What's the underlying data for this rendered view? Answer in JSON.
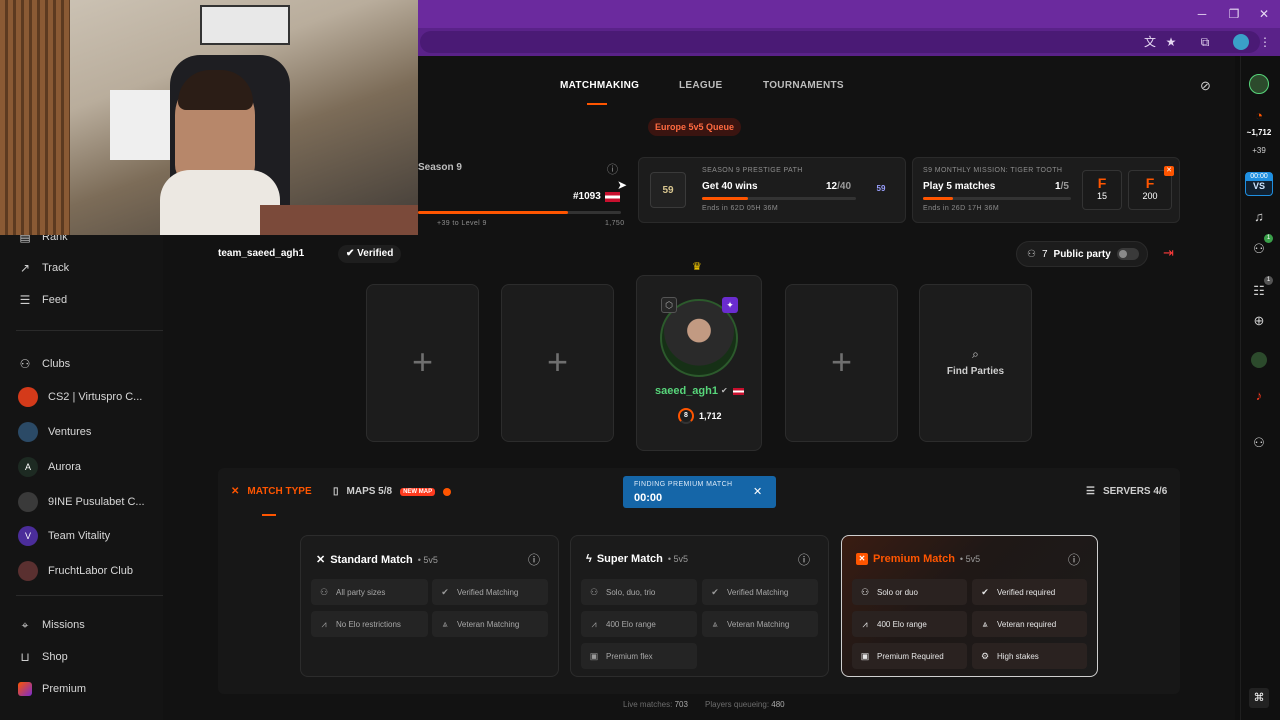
{
  "colors": {
    "accent": "#ff5500",
    "chrome": "#6b2a9e",
    "finding": "#1566a8"
  },
  "nav": {
    "matchmaking": "MATCHMAKING",
    "league": "LEAGUE",
    "tournaments": "TOURNAMENTS"
  },
  "queue_badge": "Europe 5v5 Queue",
  "season": {
    "label": "Season 9",
    "rank_pos": "#1093",
    "to_level": "+39 to Level 9",
    "max": "1,750"
  },
  "prestige": {
    "header": "SEASON 9 PRESTIGE PATH",
    "task": "Get 40 wins",
    "count": "12",
    "total": "/40",
    "ends": "Ends in 62D 05H 36M",
    "badge": "59",
    "progress": 0.3
  },
  "mission": {
    "header": "S9 MONTHLY MISSION: TIGER TOOTH",
    "task": "Play 5 matches",
    "count": "1",
    "total": "/5",
    "ends": "Ends in 26D 17H 36M",
    "reward1": "15",
    "reward2": "200",
    "progress": 0.2
  },
  "team": {
    "name": "team_saeed_agh1",
    "verified": "Verified",
    "party_count": "7",
    "public_party": "Public party"
  },
  "player": {
    "name": "saeed_agh1",
    "level": "8",
    "elo": "1,712"
  },
  "find_parties": "Find Parties",
  "tabs": {
    "match_type": "MATCH TYPE",
    "maps": "MAPS 5/8",
    "new_map": "NEW MAP",
    "servers": "SERVERS 4/6"
  },
  "finding": {
    "label": "FINDING PREMIUM MATCH",
    "timer": "00:00"
  },
  "cards": [
    {
      "title": "Standard Match",
      "mode": "• 5v5",
      "chips": [
        "All party sizes",
        "Verified Matching",
        "No Elo restrictions",
        "Veteran Matching"
      ]
    },
    {
      "title": "Super Match",
      "mode": "• 5v5",
      "chips": [
        "Solo, duo, trio",
        "Verified Matching",
        "400 Elo range",
        "Veteran Matching",
        "Premium flex"
      ]
    },
    {
      "title": "Premium Match",
      "mode": "• 5v5",
      "chips": [
        "Solo or duo",
        "Verified required",
        "400 Elo range",
        "Veteran required",
        "Premium Required",
        "High stakes"
      ]
    }
  ],
  "footer": {
    "live_label": "Live matches:",
    "live": "703",
    "queue_label": "Players queueing:",
    "queue": "480"
  },
  "sidebar": {
    "rank": "Rank",
    "track": "Track",
    "feed": "Feed",
    "clubs": "Clubs",
    "clubs_list": [
      "CS2 | Virtuspro C...",
      "Ventures",
      "Aurora",
      "9INE Pusulabet C...",
      "Team Vitality",
      "FruchtLabor Club"
    ],
    "missions": "Missions",
    "shop": "Shop",
    "premium": "Premium"
  },
  "rail": {
    "elo": "~1,712",
    "elo_delta": "+39",
    "timer": "00:00",
    "friends_badge": "1",
    "party_badge": "1"
  }
}
